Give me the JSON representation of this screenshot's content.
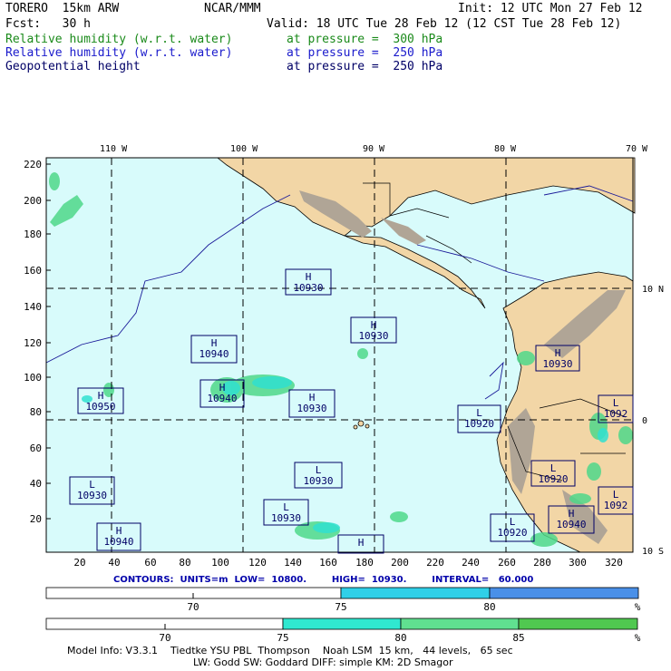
{
  "header": {
    "model": "TORERO  15km ARW",
    "org": "NCAR/MMM",
    "init": "Init: 12 UTC Mon 27 Feb 12",
    "fcst": "Fcst:   30 h",
    "valid": "Valid: 18 UTC Tue 28 Feb 12 (12 CST Tue 28 Feb 12)",
    "fields": [
      {
        "name": "Relative humidity (w.r.t. water)",
        "level": "at pressure =  300 hPa",
        "color": "#1a8a1a"
      },
      {
        "name": "Relative humidity (w.r.t. water)",
        "level": "at pressure =  250 hPa",
        "color": "#1a1acc"
      },
      {
        "name": "Geopotential height",
        "level": "at pressure =  250 hPa",
        "color": "#000066"
      }
    ]
  },
  "map": {
    "top_lon_labels": [
      "110 W",
      "100 W",
      "90 W",
      "80 W",
      "70 W"
    ],
    "right_lat_labels": [
      "10 N",
      "0",
      "10 S"
    ],
    "y_ticks": [
      "220",
      "200",
      "180",
      "160",
      "140",
      "120",
      "100",
      "80",
      "60",
      "40",
      "20"
    ],
    "x_ticks": [
      "20",
      "40",
      "60",
      "80",
      "100",
      "120",
      "140",
      "160",
      "180",
      "200",
      "220",
      "240",
      "260",
      "280",
      "300",
      "320"
    ],
    "colors": {
      "ocean": "#d8fbfb",
      "land": "#f2d6a6",
      "terrain": "#b0a596",
      "rh300": "#4fd88a",
      "rh250": "#30e0d0",
      "grid": "#000000"
    },
    "centers": [
      {
        "type": "H",
        "value": "10930"
      },
      {
        "type": "H",
        "value": "10930"
      },
      {
        "type": "H",
        "value": "10940"
      },
      {
        "type": "H",
        "value": "10940"
      },
      {
        "type": "H",
        "value": "10930"
      },
      {
        "type": "H",
        "value": "10950"
      },
      {
        "type": "H",
        "value": "10930"
      },
      {
        "type": "L",
        "value": "10920"
      },
      {
        "type": "L",
        "value": "1092"
      },
      {
        "type": "L",
        "value": "10930"
      },
      {
        "type": "L",
        "value": "10930"
      },
      {
        "type": "L",
        "value": "10920"
      },
      {
        "type": "L",
        "value": "10930"
      },
      {
        "type": "L",
        "value": "1092"
      },
      {
        "type": "H",
        "value": "10940"
      },
      {
        "type": "H",
        "value": "10940"
      },
      {
        "type": "L",
        "value": "10920"
      },
      {
        "type": "H",
        "value": ""
      }
    ]
  },
  "contours": {
    "text": "CONTOURS:  UNITS=m  LOW=  10800.        HIGH=  10930.        INTERVAL=   60.000"
  },
  "colorbar1": {
    "labels": [
      "70",
      "75",
      "80",
      "%"
    ],
    "colors": [
      "#ffffff",
      "#30d0e8",
      "#4a90e8"
    ]
  },
  "colorbar2": {
    "labels": [
      "70",
      "75",
      "80",
      "85",
      "%"
    ],
    "colors": [
      "#ffffff",
      "#30e8d0",
      "#60e090",
      "#50c850"
    ]
  },
  "footer": {
    "line1": "Model Info: V3.3.1    Tiedtke YSU PBL  Thompson    Noah LSM  15 km,   44 levels,   65 sec",
    "line2": "LW: Godd SW: Goddard DIFF: simple KM: 2D Smagor"
  }
}
